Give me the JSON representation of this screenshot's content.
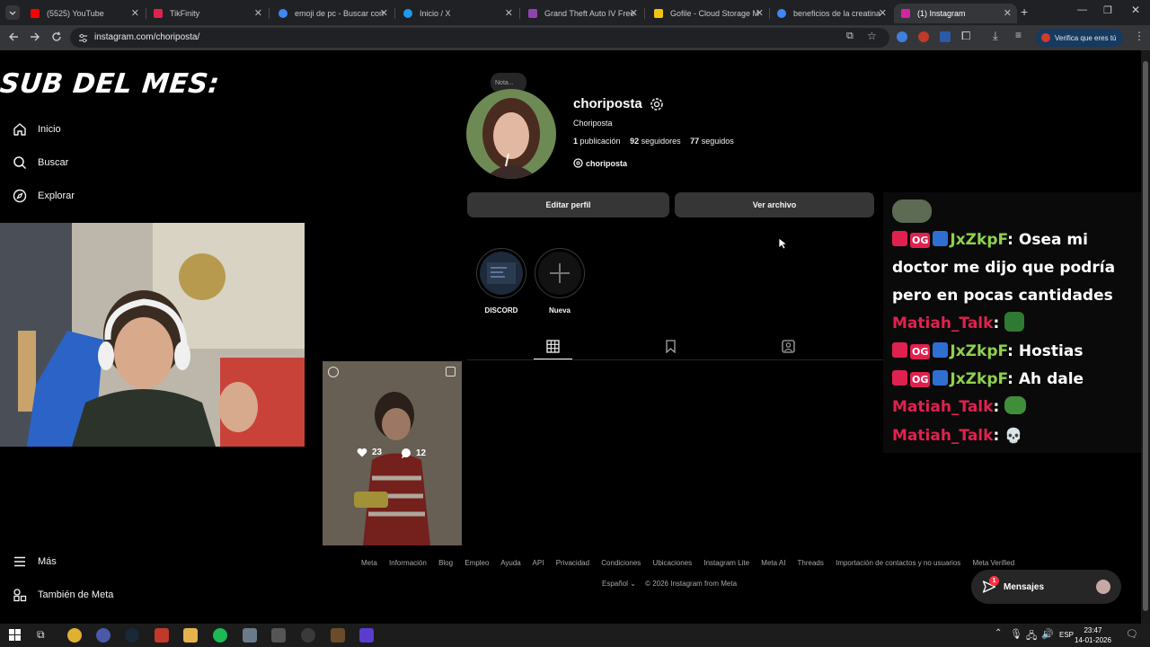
{
  "browser": {
    "tabs": [
      {
        "title": "(5525) YouTube",
        "color": "#ff0000"
      },
      {
        "title": "TikFinity",
        "color": "#e0214f"
      },
      {
        "title": "emoji de pc - Buscar con",
        "color": "#4285f4"
      },
      {
        "title": "Inicio / X",
        "color": "#1d9bf0"
      },
      {
        "title": "Grand Theft Auto IV Free",
        "color": "#8e44ad"
      },
      {
        "title": "Gofile - Cloud Storage M",
        "color": "#f1c40f"
      },
      {
        "title": "beneficios de la creatina",
        "color": "#4285f4"
      },
      {
        "title": "(1) Instagram",
        "color": "#d6249f"
      }
    ],
    "url": "instagram.com/choriposta/",
    "verify_label": "Verifica que eres tú"
  },
  "sidebar": {
    "overlay_title": "SUB DEL MES:",
    "items": [
      {
        "label": "Inicio",
        "icon": "home-icon"
      },
      {
        "label": "Buscar",
        "icon": "search-icon"
      },
      {
        "label": "Explorar",
        "icon": "compass-icon"
      }
    ],
    "more_label": "Más",
    "meta_label": "También de Meta"
  },
  "profile": {
    "note": "Nota...",
    "username": "choriposta",
    "full_name": "Choriposta",
    "posts_count": "1",
    "posts_label": "publicación",
    "followers_count": "92",
    "followers_label": "seguidores",
    "following_count": "77",
    "following_label": "seguidos",
    "threads_handle": "choriposta",
    "edit_label": "Editar perfil",
    "archive_label": "Ver archivo",
    "highlights": [
      {
        "label": "DISCORD"
      },
      {
        "label": "Nueva"
      }
    ]
  },
  "post": {
    "likes": "23",
    "comments": "12"
  },
  "footer": {
    "links": [
      "Meta",
      "Información",
      "Blog",
      "Empleo",
      "Ayuda",
      "API",
      "Privacidad",
      "Condiciones",
      "Ubicaciones",
      "Instagram Lite",
      "Meta AI",
      "Threads",
      "Importación de contactos y no usuarios",
      "Meta Verified"
    ],
    "language": "Español",
    "copyright": "© 2026 Instagram from Meta"
  },
  "messages": {
    "label": "Mensajes",
    "badge": "1"
  },
  "chat": {
    "lines": [
      {
        "nick": "JxZkpF",
        "text": "Osea mi doctor me dijo que podría pero en pocas cantidades"
      },
      {
        "nick": "Matiah_Talk",
        "text": ""
      },
      {
        "nick": "JxZkpF",
        "text": "Hostias"
      },
      {
        "nick": "JxZkpF",
        "text": "Ah dale"
      },
      {
        "nick": "Matiah_Talk",
        "text": ""
      },
      {
        "nick": "Matiah_Talk",
        "text": ""
      }
    ],
    "colors": {
      "jx": "#8fd14f",
      "matiah": "#e0214f"
    }
  },
  "taskbar": {
    "language": "ESP",
    "time": "23:47",
    "date": "14-01-2026"
  }
}
